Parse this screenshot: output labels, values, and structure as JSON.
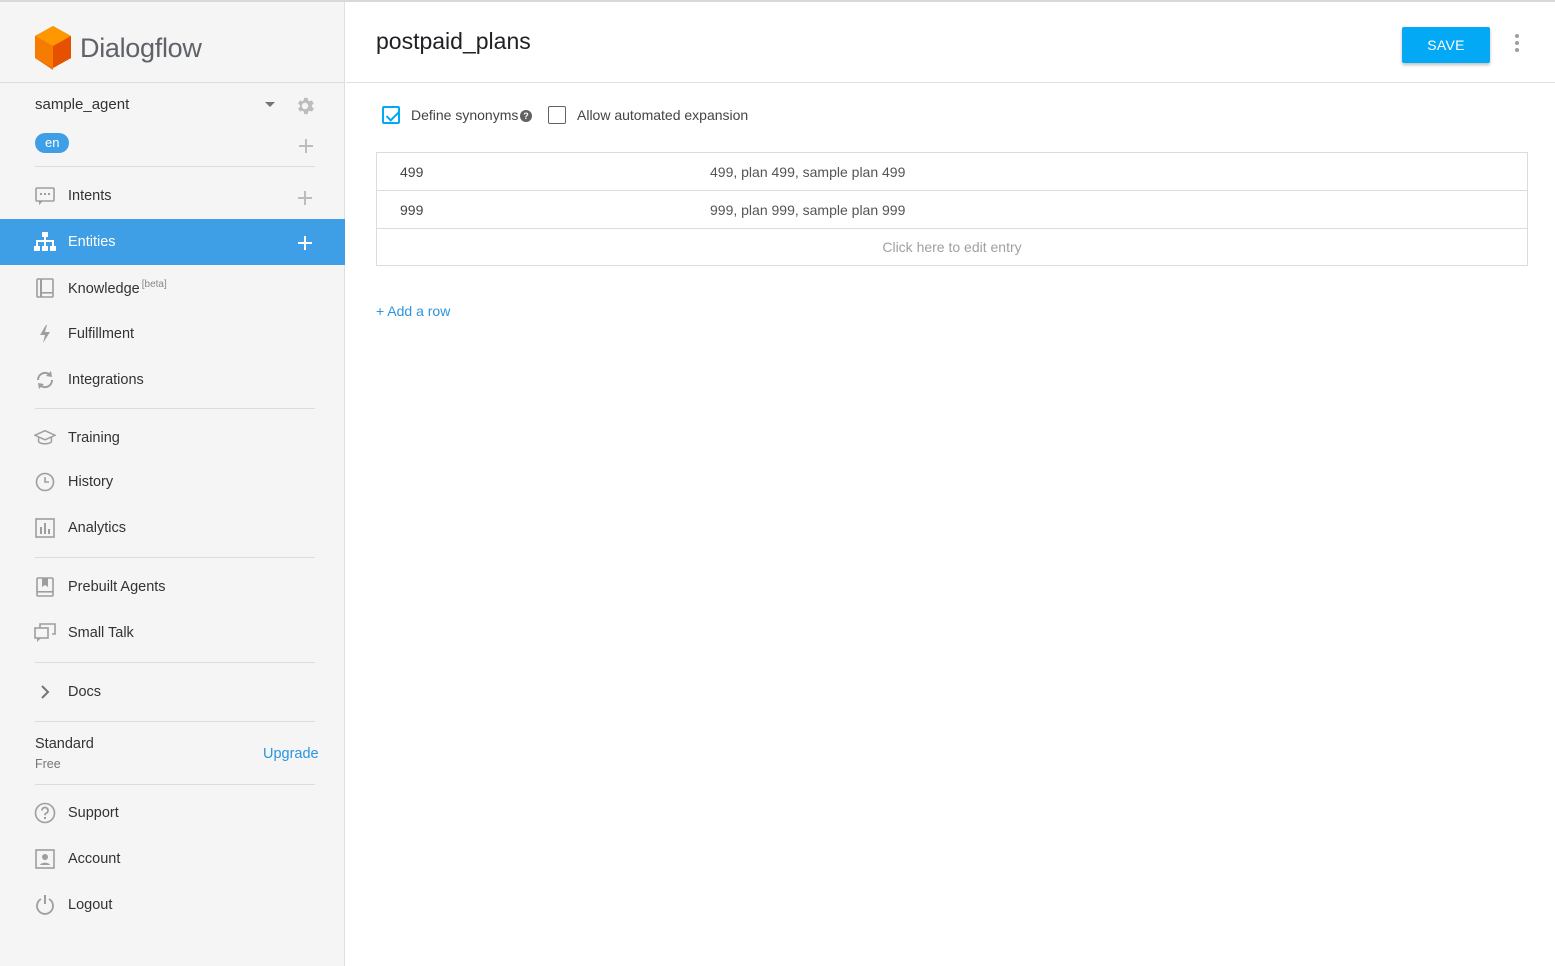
{
  "app": {
    "brand": "Dialogflow"
  },
  "sidebar": {
    "agent_name": "sample_agent",
    "language": "en",
    "nav": [
      {
        "id": "intents",
        "label": "Intents",
        "icon": "chat-bubble-icon",
        "has_add": true
      },
      {
        "id": "entities",
        "label": "Entities",
        "icon": "hierarchy-icon",
        "has_add": true,
        "active": true
      },
      {
        "id": "knowledge",
        "label": "Knowledge",
        "badge": "[beta]",
        "icon": "book-icon"
      },
      {
        "id": "fulfillment",
        "label": "Fulfillment",
        "icon": "lightning-icon"
      },
      {
        "id": "integrations",
        "label": "Integrations",
        "icon": "sync-icon"
      },
      {
        "id": "training",
        "label": "Training",
        "icon": "graduation-cap-icon"
      },
      {
        "id": "history",
        "label": "History",
        "icon": "clock-icon"
      },
      {
        "id": "analytics",
        "label": "Analytics",
        "icon": "bar-chart-icon"
      },
      {
        "id": "prebuilt",
        "label": "Prebuilt Agents",
        "icon": "bookmark-book-icon"
      },
      {
        "id": "smalltalk",
        "label": "Small Talk",
        "icon": "chat-bubbles-icon"
      },
      {
        "id": "docs",
        "label": "Docs",
        "icon": "chevron-right-icon"
      }
    ],
    "plan": {
      "name": "Standard",
      "tier": "Free",
      "upgrade_label": "Upgrade"
    },
    "footer": [
      {
        "id": "support",
        "label": "Support",
        "icon": "help-circle-icon"
      },
      {
        "id": "account",
        "label": "Account",
        "icon": "account-box-icon"
      },
      {
        "id": "logout",
        "label": "Logout",
        "icon": "power-icon"
      }
    ]
  },
  "entity": {
    "title": "postpaid_plans",
    "save_label": "SAVE",
    "define_synonyms": {
      "label": "Define synonyms",
      "checked": true
    },
    "automated_expansion": {
      "label": "Allow automated expansion",
      "checked": false
    },
    "rows": [
      {
        "reference": "499",
        "synonyms": "499, plan 499, sample plan 499"
      },
      {
        "reference": "999",
        "synonyms": "999, plan 999, sample plan 999"
      }
    ],
    "edit_hint": "Click here to edit entry",
    "add_row_label": "+ Add a row"
  },
  "colors": {
    "accent": "#3f9fe6",
    "save": "#03a9f4",
    "logo": "#f57c00"
  }
}
